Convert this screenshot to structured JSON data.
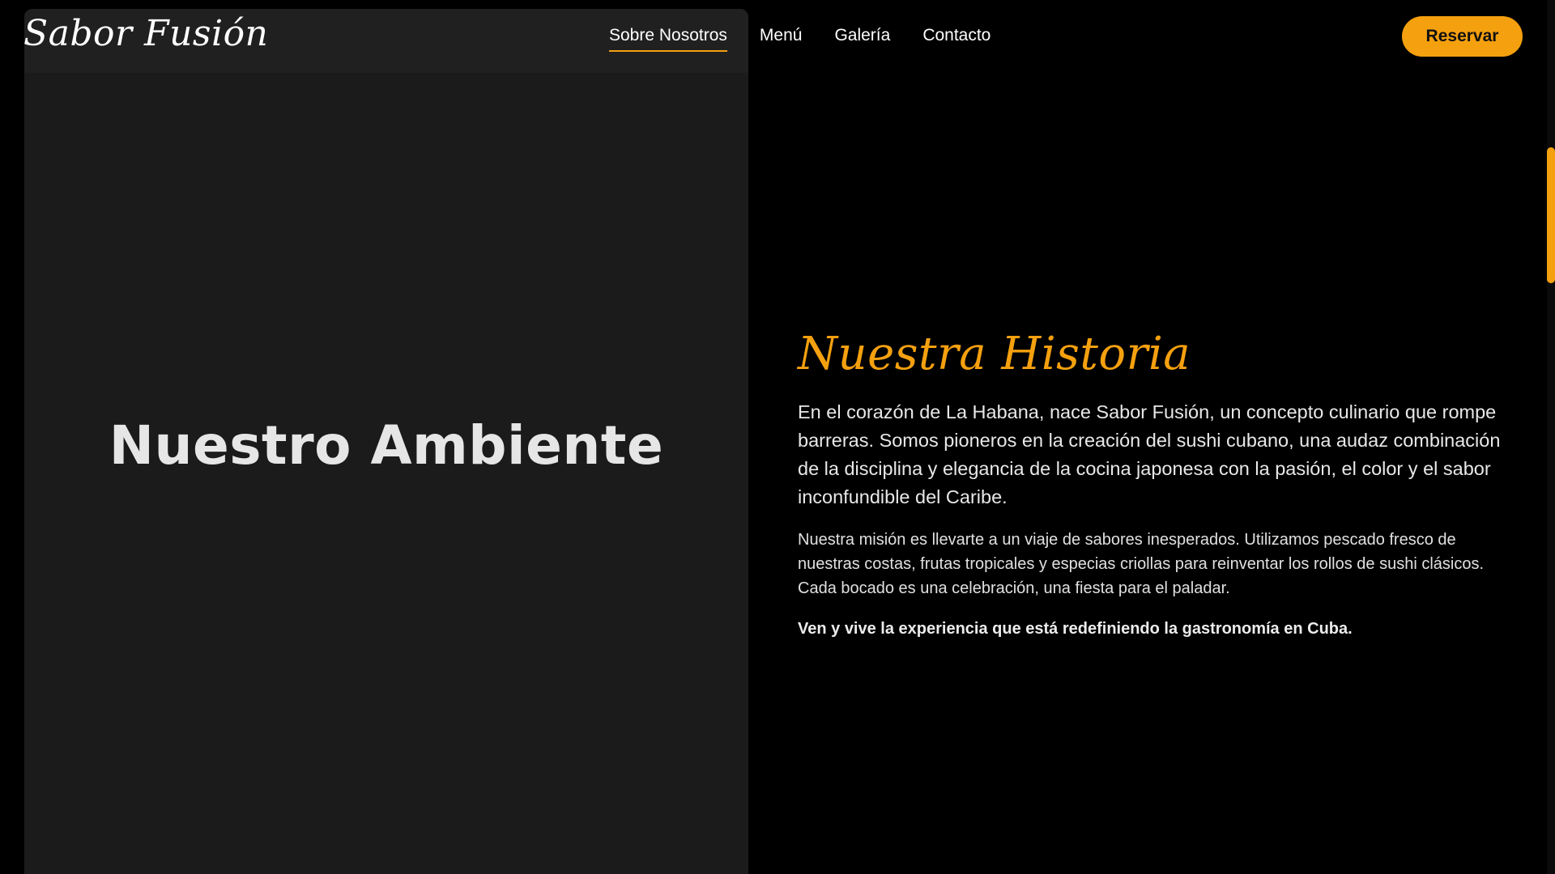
{
  "header": {
    "logo": "Sabor Fusión",
    "nav": [
      {
        "label": "Sobre Nosotros",
        "active": true
      },
      {
        "label": "Menú",
        "active": false
      },
      {
        "label": "Galería",
        "active": false
      },
      {
        "label": "Contacto",
        "active": false
      }
    ],
    "cta_label": "Reservar"
  },
  "ambient": {
    "title": "Nuestro Ambiente"
  },
  "story": {
    "title": "Nuestra Historia",
    "lead": "En el corazón de La Habana, nace Sabor Fusión, un concepto culinario que rompe barreras. Somos pioneros en la creación del sushi cubano, una audaz combinación de la disciplina y elegancia de la cocina japonesa con la pasión, el color y el sabor inconfundible del Caribe.",
    "body": "Nuestra misión es llevarte a un viaje de sabores inesperados. Utilizamos pescado fresco de nuestras costas, frutas tropicales y especias criollas para reinventar los rollos de sushi clásicos. Cada bocado es una celebración, una fiesta para el paladar.",
    "closing": "Ven y vive la experiencia que está redefiniendo la gastronomía en Cuba."
  },
  "colors": {
    "accent": "#f5a00f",
    "background": "#000000",
    "panel": "#1b1b1b"
  }
}
